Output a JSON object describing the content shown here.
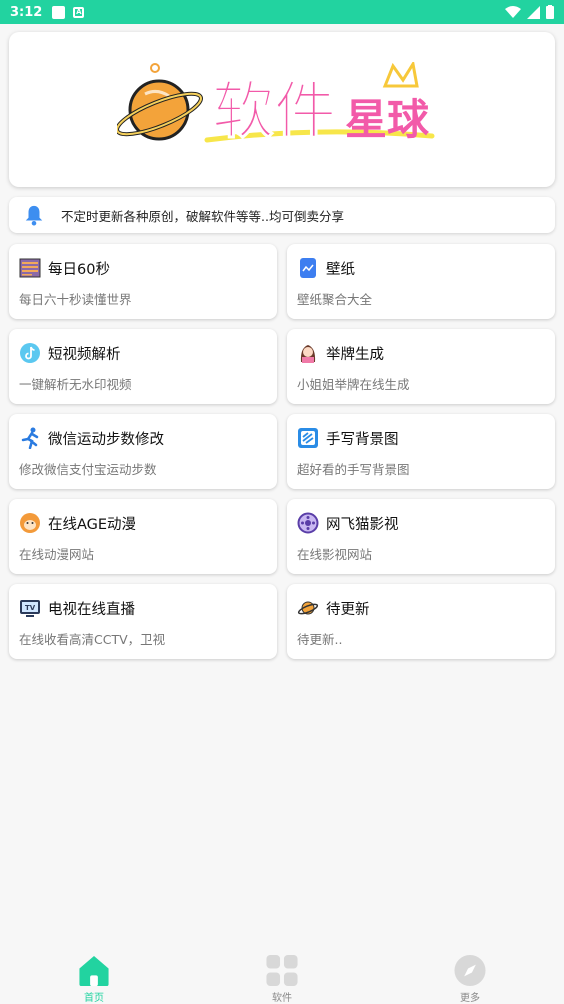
{
  "status": {
    "time": "3:12"
  },
  "banner": {
    "logo_text_1": "软件",
    "logo_text_2": "星球"
  },
  "notice": {
    "text": "不定时更新各种原创，破解软件等等..均可倒卖分享"
  },
  "cards": [
    {
      "title": "每日60秒",
      "subtitle": "每日六十秒读懂世界",
      "icon": "news-icon"
    },
    {
      "title": "壁纸",
      "subtitle": "壁纸聚合大全",
      "icon": "wallpaper-icon"
    },
    {
      "title": "短视频解析",
      "subtitle": "一键解析无水印视频",
      "icon": "tiktok-icon"
    },
    {
      "title": "举牌生成",
      "subtitle": "小姐姐举牌在线生成",
      "icon": "girl-icon"
    },
    {
      "title": "微信运动步数修改",
      "subtitle": "修改微信支付宝运动步数",
      "icon": "running-icon"
    },
    {
      "title": "手写背景图",
      "subtitle": "超好看的手写背景图",
      "icon": "handwriting-icon"
    },
    {
      "title": "在线AGE动漫",
      "subtitle": "在线动漫网站",
      "icon": "monkey-icon"
    },
    {
      "title": "网飞猫影视",
      "subtitle": "在线影视网站",
      "icon": "cat-film-icon"
    },
    {
      "title": "电视在线直播",
      "subtitle": "在线收看高清CCTV，卫视",
      "icon": "tv-icon"
    },
    {
      "title": "待更新",
      "subtitle": "待更新..",
      "icon": "planet-icon"
    }
  ],
  "tabs": [
    {
      "label": "首页",
      "icon": "home-icon",
      "active": true
    },
    {
      "label": "软件",
      "icon": "grid-icon",
      "active": false
    },
    {
      "label": "更多",
      "icon": "compass-icon",
      "active": false
    }
  ],
  "colors": {
    "accent": "#22d3a0",
    "logo_pink": "#f25aa9",
    "logo_orange": "#f3a33a"
  }
}
